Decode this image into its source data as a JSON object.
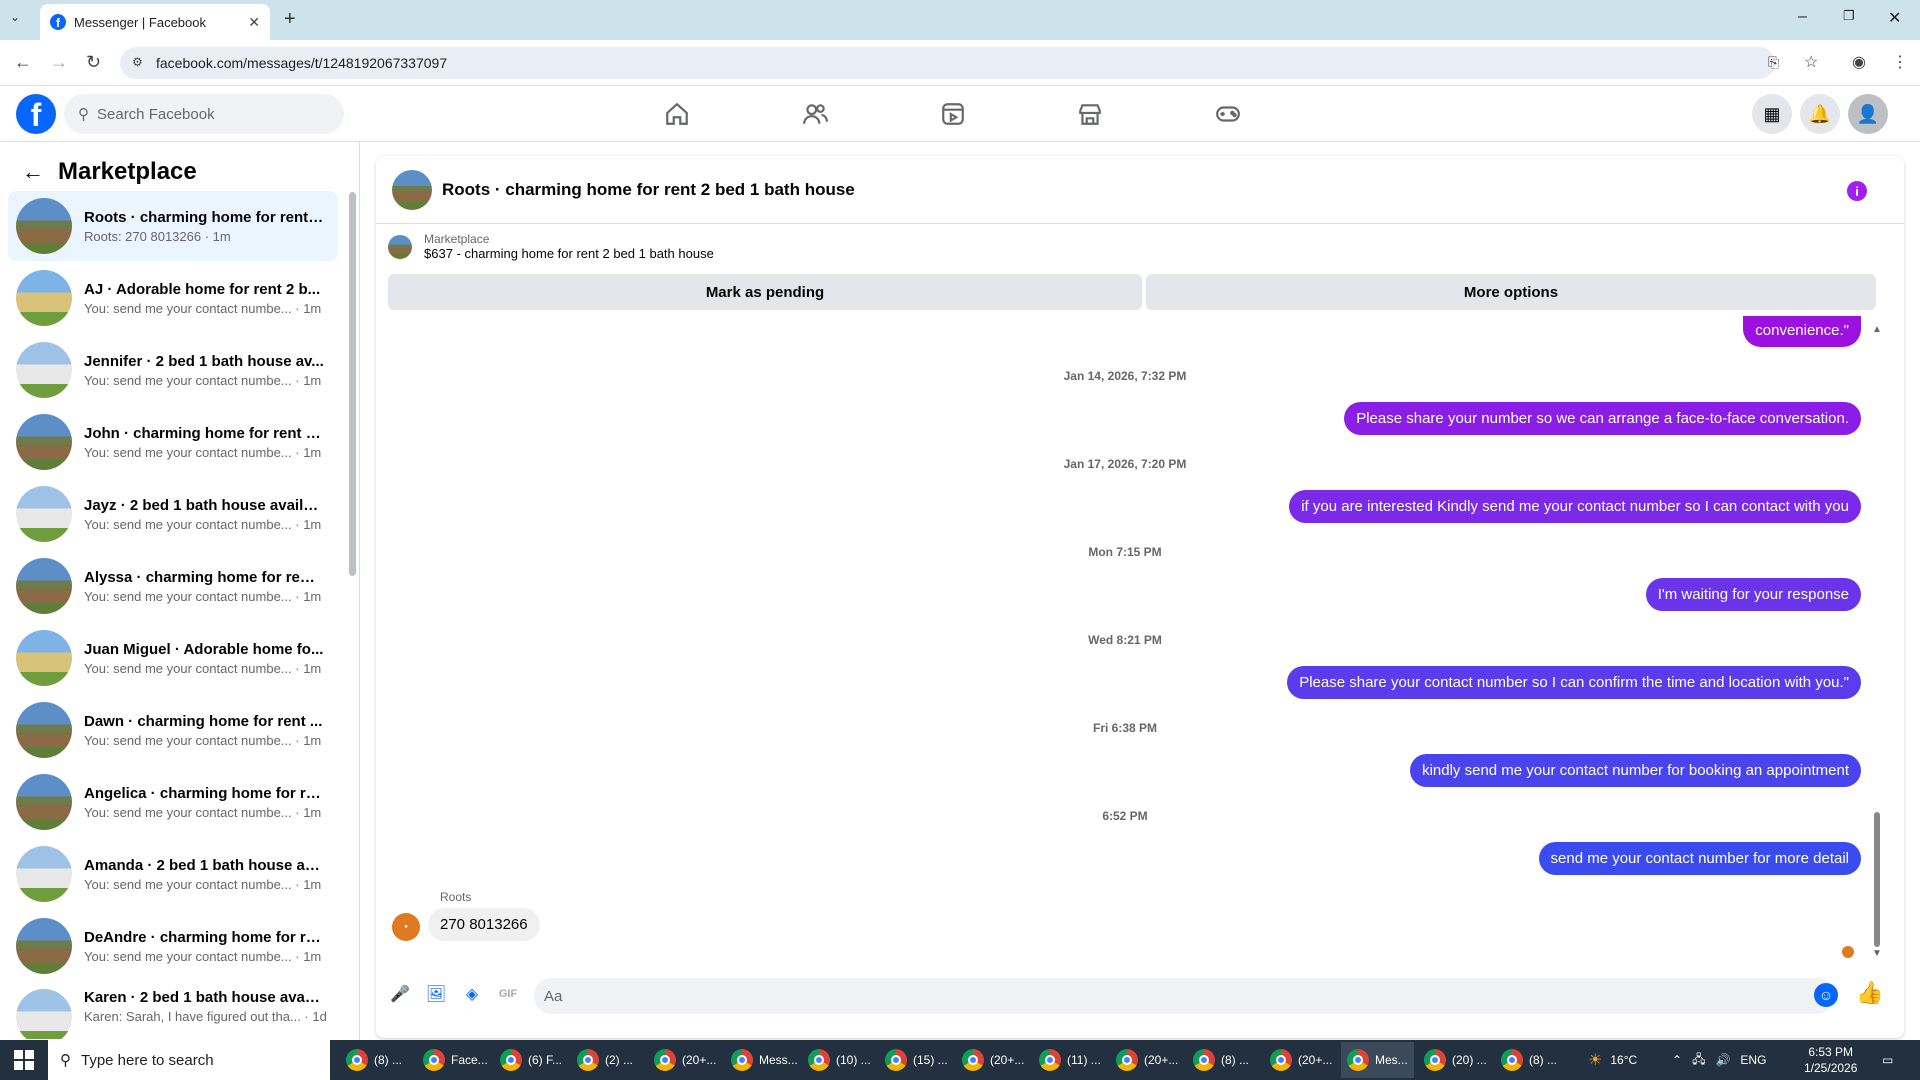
{
  "browser": {
    "tab_title": "Messenger | Facebook",
    "url": "facebook.com/messages/t/1248192067337097"
  },
  "fb": {
    "search_placeholder": "Search Facebook"
  },
  "sidebar": {
    "title": "Marketplace",
    "conversations": [
      {
        "name": "Roots · charming home for rent ...",
        "preview": "Roots: 270 8013266 · 1m",
        "active": true
      },
      {
        "name": "AJ · Adorable home for rent 2 b...",
        "preview": "You: send me your contact numbe... · 1m"
      },
      {
        "name": "Jennifer · 2 bed 1 bath house av...",
        "preview": "You: send me your contact numbe... · 1m"
      },
      {
        "name": "John · charming home for rent 2...",
        "preview": "You: send me your contact numbe... · 1m"
      },
      {
        "name": "Jayz · 2 bed 1 bath house availab...",
        "preview": "You: send me your contact numbe... · 1m"
      },
      {
        "name": "Alyssa · charming home for rent...",
        "preview": "You: send me your contact numbe... · 1m"
      },
      {
        "name": "Juan Miguel · Adorable home fo...",
        "preview": "You: send me your contact numbe... · 1m"
      },
      {
        "name": "Dawn · charming home for rent ...",
        "preview": "You: send me your contact numbe... · 1m"
      },
      {
        "name": "Angelica · charming home for re...",
        "preview": "You: send me your contact numbe... · 1m"
      },
      {
        "name": "Amanda · 2 bed 1 bath house av...",
        "preview": "You: send me your contact numbe... · 1m"
      },
      {
        "name": "DeAndre · charming home for re...",
        "preview": "You: send me your contact numbe... · 1m"
      },
      {
        "name": "Karen · 2 bed 1 bath house avail...",
        "preview": "Karen: Sarah, I have figured out tha... · 1d"
      }
    ]
  },
  "chat": {
    "title": "Roots · charming home for rent 2 bed 1 bath house",
    "listing_source": "Marketplace",
    "listing": "$637 - charming home for rent 2 bed 1 bath house",
    "mark_pending": "Mark as pending",
    "more_options": "More options",
    "messages": [
      {
        "type": "out",
        "text": "convenience.\"",
        "color": "#9b12e0"
      },
      {
        "type": "ts",
        "text": "Jan 14, 2026, 7:32 PM"
      },
      {
        "type": "out",
        "text": "Please share your number so we can arrange a face-to-face conversation.",
        "color": "#8a1ee6"
      },
      {
        "type": "ts",
        "text": "Jan 17, 2026, 7:20 PM"
      },
      {
        "type": "out",
        "text": "if you are interested Kindly send me your contact number so I can contact with you",
        "color": "#7a2ae8"
      },
      {
        "type": "ts",
        "text": "Mon 7:15 PM"
      },
      {
        "type": "out",
        "text": "I'm waiting for your response",
        "color": "#6a34ea"
      },
      {
        "type": "ts",
        "text": "Wed 8:21 PM"
      },
      {
        "type": "out",
        "text": "Please share your contact number so I can confirm the time and location with you.\"",
        "color": "#5a3cec"
      },
      {
        "type": "ts",
        "text": "Fri 6:38 PM"
      },
      {
        "type": "out",
        "text": "kindly send me your contact number for booking an appointment",
        "color": "#4a44ee"
      },
      {
        "type": "ts",
        "text": "6:52 PM"
      },
      {
        "type": "out",
        "text": "send me your contact number for more detail",
        "color": "#3a4cf0"
      }
    ],
    "incoming_sender": "Roots",
    "incoming_text": "270 8013266",
    "input_placeholder": "Aa"
  },
  "taskbar": {
    "search_placeholder": "Type here to search",
    "items": [
      "(8) ...",
      "Face...",
      "(6) F...",
      "(2) ...",
      "(20+...",
      "Mess...",
      "(10) ...",
      "(15) ...",
      "(20+...",
      "(11) ...",
      "(20+...",
      "(8) ...",
      "(20+...",
      "Mes...",
      "(20) ...",
      "(8) ..."
    ],
    "temperature": "16°C",
    "language": "ENG",
    "time": "6:53 PM",
    "date": "1/25/2026"
  }
}
